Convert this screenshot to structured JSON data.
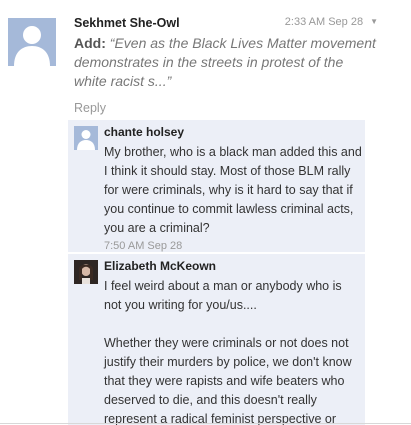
{
  "main_comment": {
    "author": "Sekhmet She-Owl",
    "timestamp": "2:33 AM Sep 28",
    "menu_icon": "caret-down-icon",
    "add_label": "Add:",
    "quote": "“Even as the Black Lives Matter movement demonstrates in the streets in protest of the white racist s...”",
    "reply_label": "Reply",
    "avatar_icon": "default-user-avatar"
  },
  "replies": [
    {
      "author": "chante holsey",
      "text": "My brother, who is a black man added this and I think it should stay. Most of those BLM rally for were criminals, why is it hard to say that if you continue to commit lawless criminal acts, you are a criminal?",
      "timestamp": "7:50 AM Sep 28",
      "avatar_icon": "default-user-avatar"
    },
    {
      "author": "Elizabeth McKeown",
      "text": "I feel weird about a man or anybody who is not you writing for you/us....\n\nWhether they were criminals or not does not justify their murders by police, we don't know that they were rapists and wife beaters who deserved to die, and this doesn't really represent a radical feminist perspective or",
      "avatar_icon": "photo-avatar"
    }
  ],
  "colors": {
    "reply_background": "#eceff7",
    "avatar_default": "#a5b9d9",
    "muted_text": "#999999"
  }
}
